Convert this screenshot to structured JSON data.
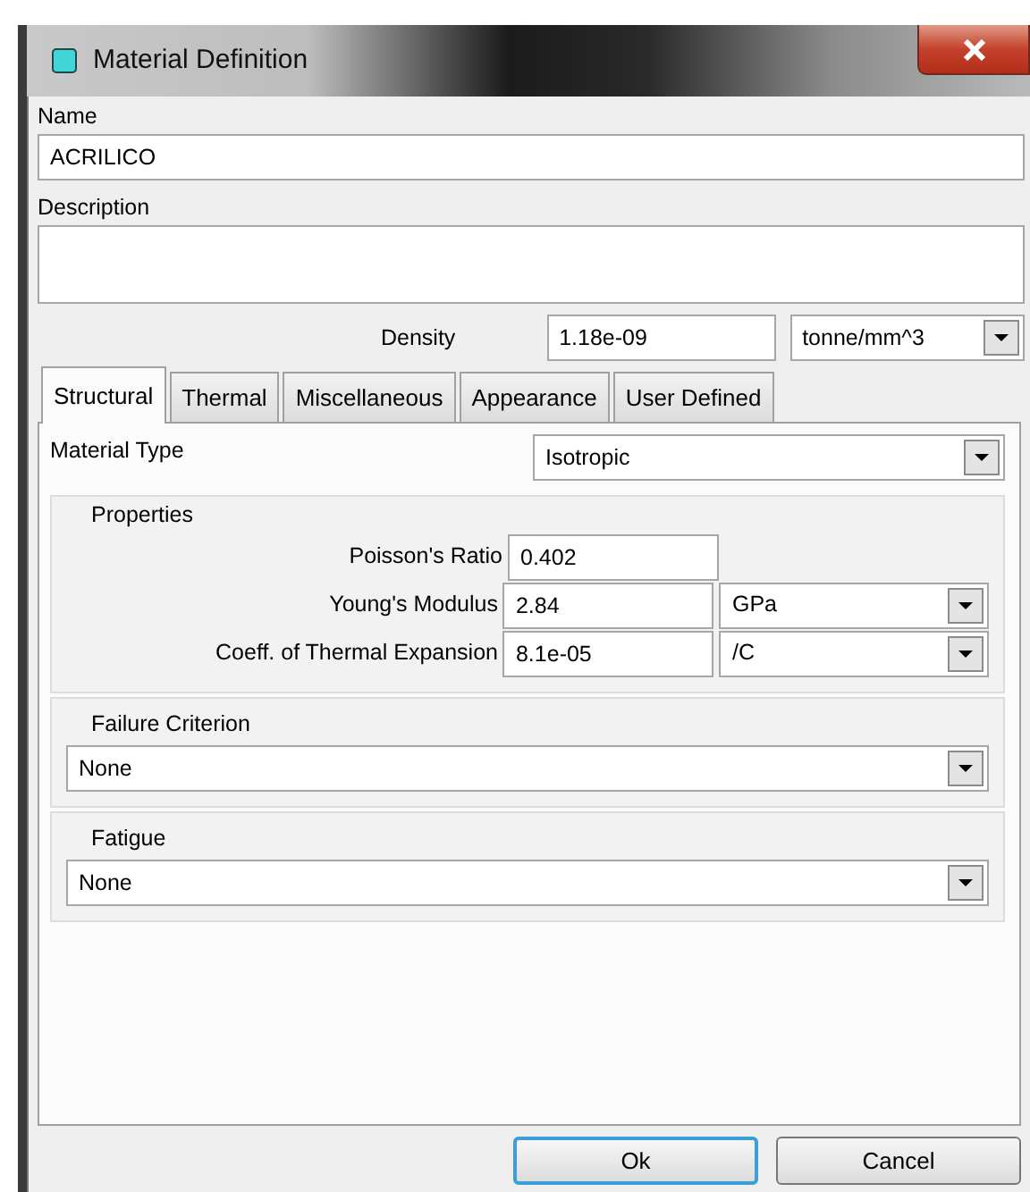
{
  "window": {
    "title": "Material Definition"
  },
  "name": {
    "label": "Name",
    "value": "ACRILICO"
  },
  "description": {
    "label": "Description"
  },
  "density": {
    "label": "Density",
    "value": "1.18e-09",
    "unit": "tonne/mm^3"
  },
  "tabs": [
    {
      "label": "Structural",
      "selected": true
    },
    {
      "label": "Thermal",
      "selected": false
    },
    {
      "label": "Miscellaneous",
      "selected": false
    },
    {
      "label": "Appearance",
      "selected": false
    },
    {
      "label": "User Defined",
      "selected": false
    }
  ],
  "material_type": {
    "label": "Material Type",
    "value": "Isotropic"
  },
  "properties": {
    "title": "Properties",
    "rows": [
      {
        "label": "Poisson's Ratio",
        "value": "0.402"
      },
      {
        "label": "Young's Modulus",
        "value": "2.84",
        "unit": "GPa"
      },
      {
        "label": "Coeff. of Thermal Expansion",
        "value": "8.1e-05",
        "unit": "/C"
      }
    ]
  },
  "failure_criterion": {
    "title": "Failure Criterion",
    "value": "None"
  },
  "fatigue": {
    "title": "Fatigue",
    "value": "None"
  },
  "buttons": [
    {
      "label": "Ok",
      "focused": true
    },
    {
      "label": "Cancel",
      "focused": false
    }
  ]
}
